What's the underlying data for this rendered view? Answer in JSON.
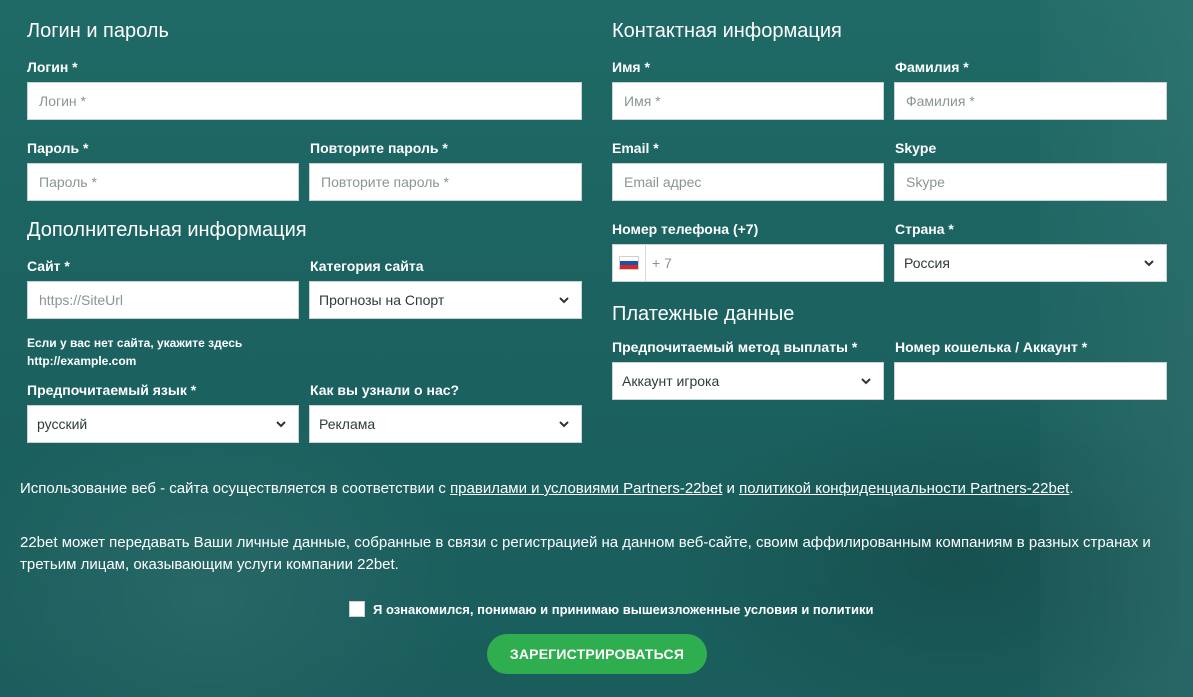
{
  "sections": {
    "login": {
      "title": "Логин и пароль",
      "login_label": "Логин *",
      "login_placeholder": "Логин *",
      "password_label": "Пароль *",
      "password_placeholder": "Пароль *",
      "repeat_label": "Повторите пароль *",
      "repeat_placeholder": "Повторите пароль *"
    },
    "additional": {
      "title": "Дополнительная информация",
      "site_label": "Сайт *",
      "site_placeholder": "https://SiteUrl",
      "category_label": "Категория сайта",
      "category_value": "Прогнозы на Спорт",
      "note_line1": "Если у вас нет сайта, укажите здесь",
      "note_line2": "http://example.com",
      "language_label": "Предпочитаемый язык *",
      "language_value": "русский",
      "source_label": "Как вы узнали о нас?",
      "source_value": "Реклама"
    },
    "contact": {
      "title": "Контактная информация",
      "first_label": "Имя *",
      "first_placeholder": "Имя *",
      "last_label": "Фамилия *",
      "last_placeholder": "Фамилия *",
      "email_label": "Email *",
      "email_placeholder": "Email адрес",
      "skype_label": "Skype",
      "skype_placeholder": "Skype",
      "phone_label": "Номер телефона (+7)",
      "phone_placeholder": "+ 7",
      "country_label": "Страна *",
      "country_value": "Россия"
    },
    "payment": {
      "title": "Платежные данные",
      "method_label": "Предпочитаемый метод выплаты *",
      "method_value": "Аккаунт игрока",
      "wallet_label": "Номер кошелька / Аккаунт *",
      "wallet_placeholder": ""
    }
  },
  "legal": {
    "p1_prefix": "Использование веб - сайта осуществляется в соответствии с ",
    "p1_link1": "правилами и условиями Partners-22bet",
    "p1_mid": " и ",
    "p1_link2": "политикой конфиденциальности Partners-22bet",
    "p1_suffix": ".",
    "p2": "22bet может передавать Ваши личные данные, собранные в связи с регистрацией на данном веб-сайте, своим аффилированным компаниям в разных странах и третьим лицам, оказывающим услуги компании 22bet."
  },
  "agree_text": "Я ознакомился, понимаю и принимаю вышеизложенные условия и политики",
  "submit_label": "ЗАРЕГИСТРИРОВАТЬСЯ",
  "icons": {
    "chevron": "chevron-down-icon",
    "flag": "russia-flag-icon"
  }
}
